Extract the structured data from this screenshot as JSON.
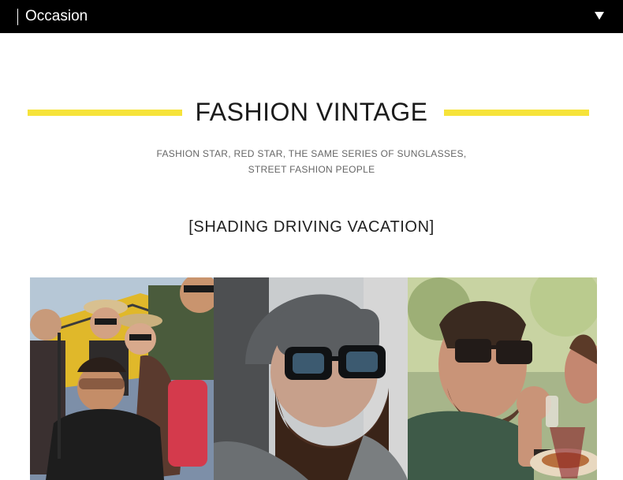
{
  "header": {
    "title": "Occasion",
    "toggle_icon": "triangle-down-icon"
  },
  "heading": {
    "title": "FASHION VINTAGE",
    "subtitle_line1": "FASHION STAR, RED STAR, THE SAME SERIES OF SUNGLASSES,",
    "subtitle_line2": "STREET FASHION PEOPLE",
    "accent_color": "#f6e33a"
  },
  "tags": "[SHADING  DRIVING   VACATION]",
  "photos": [
    {
      "subject": "group-selfie-photo"
    },
    {
      "subject": "bearded-man-beanie-photo"
    },
    {
      "subject": "man-dining-photo"
    }
  ]
}
